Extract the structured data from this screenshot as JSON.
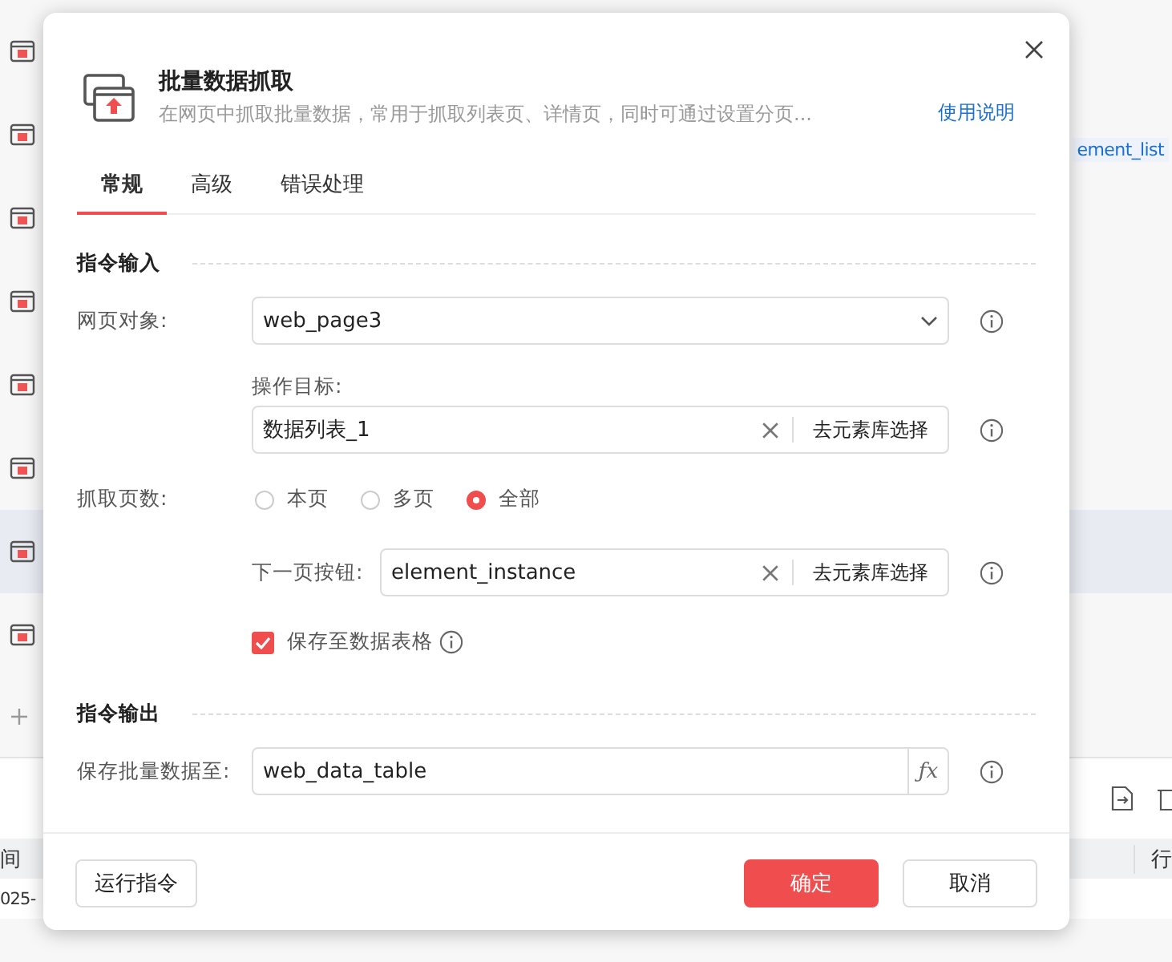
{
  "background": {
    "tag": "ement_list",
    "table": {
      "columns": [
        {
          "label": "间"
        },
        {
          "label": "行"
        }
      ],
      "rows": [
        {
          "column_1": "025-"
        }
      ]
    }
  },
  "dialog": {
    "title": "批量数据抓取",
    "description": "在网页中抓取批量数据，常用于抓取列表页、详情页，同时可通过设置分页...",
    "help_link": "使用说明",
    "tabs": [
      {
        "label": "常规",
        "selected": true
      },
      {
        "label": "高级",
        "selected": false
      },
      {
        "label": "错误处理",
        "selected": false
      }
    ],
    "input_section": {
      "title": "指令输入",
      "web_page": {
        "label": "网页对象:",
        "value": "web_page3"
      },
      "target": {
        "label": "操作目标:",
        "value": "数据列表_1",
        "button": "去元素库选择"
      },
      "pages": {
        "label": "抓取页数:",
        "options": [
          {
            "label": "本页",
            "selected": false
          },
          {
            "label": "多页",
            "selected": false
          },
          {
            "label": "全部",
            "selected": true
          }
        ]
      },
      "next_button": {
        "label": "下一页按钮:",
        "value": "element_instance",
        "button": "去元素库选择"
      },
      "save_to_table": {
        "label": "保存至数据表格",
        "checked": true
      }
    },
    "output_section": {
      "title": "指令输出",
      "save_to": {
        "label": "保存批量数据至:",
        "value": "web_data_table",
        "fx": "ƒx"
      }
    },
    "footer": {
      "run_button": "运行指令",
      "confirm_button": "确定",
      "cancel_button": "取消"
    }
  }
}
